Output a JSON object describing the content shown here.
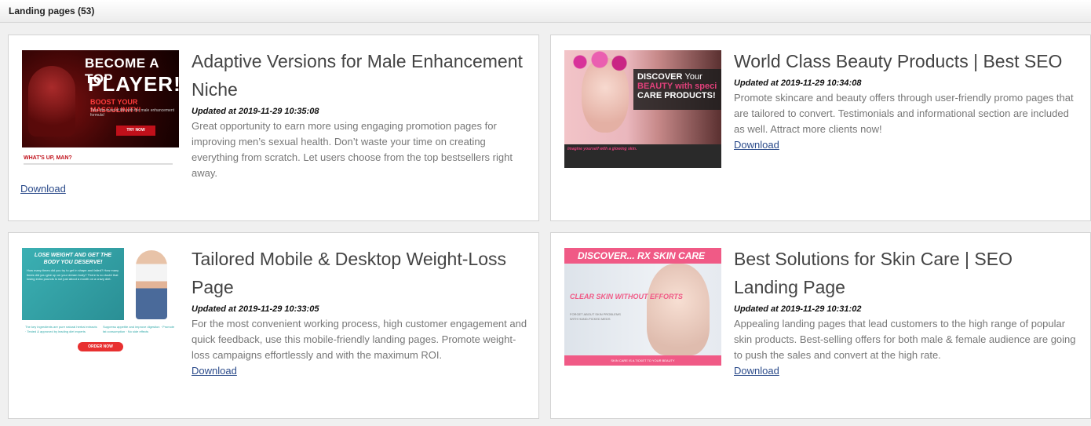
{
  "header": {
    "title": "Landing pages (53)"
  },
  "cards": [
    {
      "title": "Adaptive Versions for Male Enhancement Niche",
      "updated": "Updated at 2019-11-29 10:35:08",
      "description": "Great opportunity to earn more using engaging promotion pages for improving men’s sexual health. Don’t waste your time on creating everything from scratch. Let users choose from the top bestsellers right away.",
      "download": "Download",
      "thumb": {
        "line1": "BECOME A TOP",
        "line2": "PLAYER!",
        "line3": "BOOST YOUR MASCULINITY!",
        "line4": "Take the most of life with the male enhancement formula!",
        "button": "TRY NOW",
        "sub": "WHAT'S UP, MAN?"
      }
    },
    {
      "title": "World Class Beauty Products | Best SEO",
      "updated": "Updated at 2019-11-29 10:34:08",
      "description": "Promote skincare and beauty offers through user-friendly promo pages that are tailored to convert. Testimonials and informational section are included as well. Attract more clients now!",
      "download": "Download",
      "thumb": {
        "line1a": "DISCOVER",
        "line1b": "Your",
        "line2": "BEAUTY with speci",
        "line3": "CARE PRODUCTS!",
        "tag": "Imagine yourself with a glowing skin."
      }
    },
    {
      "title": "Tailored Mobile & Desktop Weight-Loss Page",
      "updated": "Updated at 2019-11-29 10:33:05",
      "description": "For the most convenient working process, high customer engagement and quick feedback, use this mobile-friendly landing pages. Promote weight-loss campaigns effortlessly and with the maximum ROI.",
      "download": "Download",
      "thumb": {
        "heading": "LOSE WEIGHT AND GET THE BODY YOU DESERVE!",
        "left": "The key ingredients are pure natural herbal extracts · Tested & approved by leading diet experts",
        "right": "Suppress appetite and improve digestion · Promote fat consumption · No side effects",
        "button": "ORDER NOW"
      }
    },
    {
      "title": "Best Solutions for Skin Care | SEO Landing Page",
      "updated": "Updated at 2019-11-29 10:31:02",
      "description": "Appealing landing pages that lead customers to the high range of popular skin products. Best-selling offers for both male & female audience are going to push the sales and convert at the high rate.",
      "download": "Download",
      "thumb": {
        "banner": "DISCOVER... RX SKIN CARE",
        "clear": "CLEAR SKIN WITHOUT EFFORTS",
        "small": "FORGET ABOUT SKIN PROBLEMS WITH HAND-PICKED MEDS",
        "foot": "SKIN CARE IS A TICKET TO YOUR BEAUTY"
      }
    }
  ]
}
